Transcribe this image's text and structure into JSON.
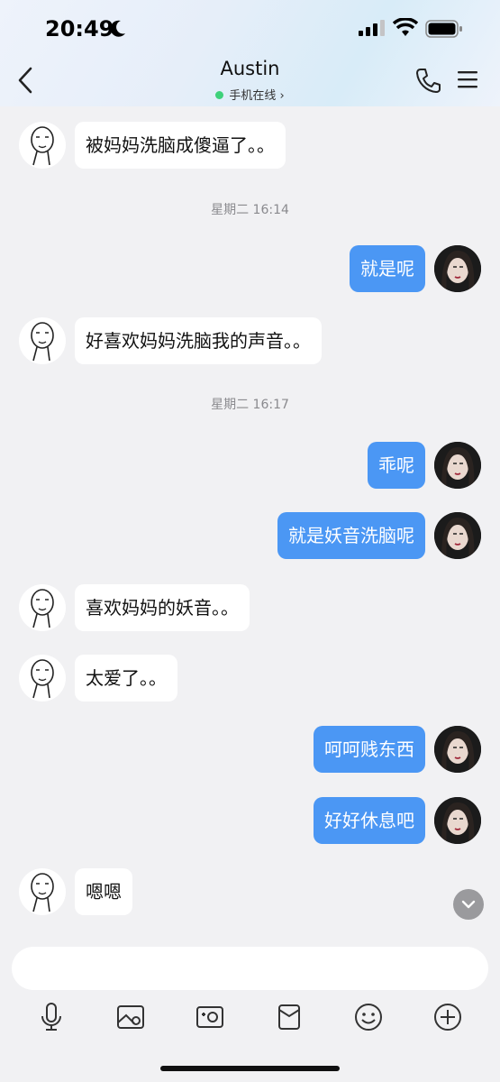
{
  "status_bar": {
    "time": "20:49"
  },
  "header": {
    "title": "Austin",
    "status": "手机在线",
    "status_chevron": "›"
  },
  "messages": [
    {
      "side": "left",
      "text": "被妈妈洗脑成傻逼了。。"
    },
    {
      "type": "timestamp",
      "text": "星期二 16:14"
    },
    {
      "side": "right",
      "text": "就是呢"
    },
    {
      "side": "left",
      "text": "好喜欢妈妈洗脑我的声音。。"
    },
    {
      "type": "timestamp",
      "text": "星期二 16:17"
    },
    {
      "side": "right",
      "text": "乖呢"
    },
    {
      "side": "right",
      "text": "就是妖音洗脑呢"
    },
    {
      "side": "left",
      "text": "喜欢妈妈的妖音。。"
    },
    {
      "side": "left",
      "text": "太爱了。。"
    },
    {
      "side": "right",
      "text": "呵呵贱东西"
    },
    {
      "side": "right",
      "text": "好好休息吧"
    },
    {
      "side": "left",
      "text": "嗯嗯"
    }
  ],
  "toolbar": [
    "microphone-icon",
    "image-icon",
    "camera-icon",
    "red-packet-icon",
    "emoji-icon",
    "plus-icon"
  ],
  "colors": {
    "accent": "#4b97f4",
    "online": "#3ed17a",
    "background": "#f1f1f3"
  }
}
